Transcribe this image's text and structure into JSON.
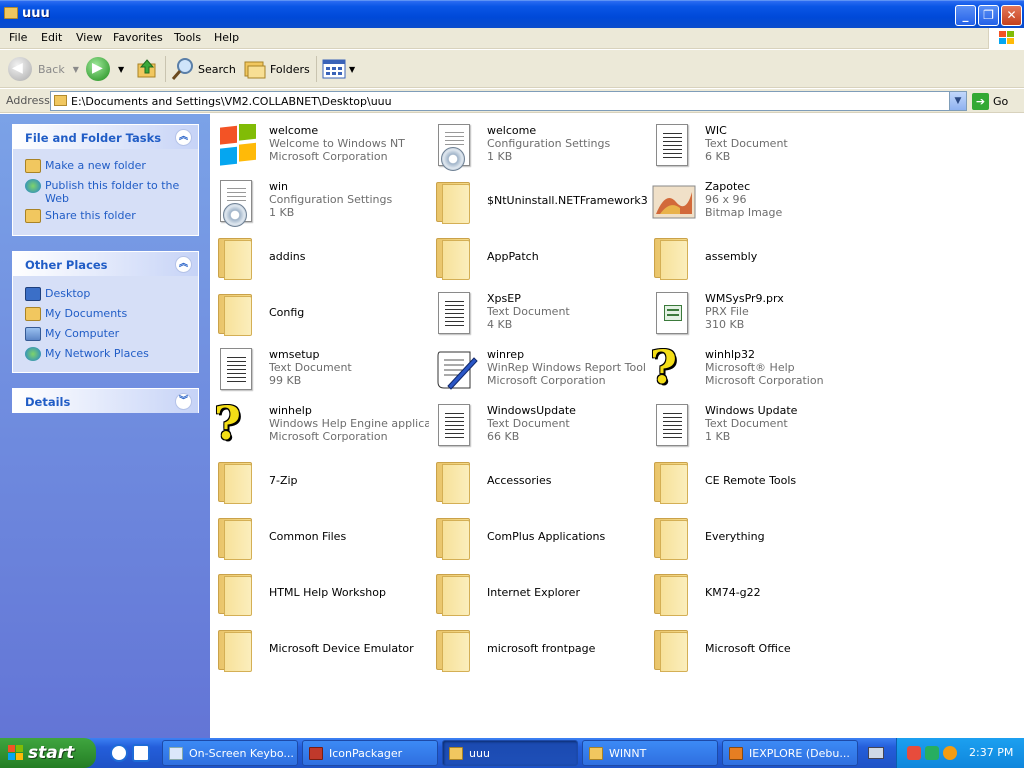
{
  "window": {
    "title": "uuu"
  },
  "menubar": {
    "items": [
      "File",
      "Edit",
      "View",
      "Favorites",
      "Tools",
      "Help"
    ]
  },
  "toolbar": {
    "back_label": "Back",
    "search_label": "Search",
    "folders_label": "Folders"
  },
  "address": {
    "label": "Address",
    "value": "E:\\Documents and Settings\\VM2.COLLABNET\\Desktop\\uuu",
    "go_label": "Go"
  },
  "tasks_panel": {
    "title": "File and Folder Tasks",
    "items": [
      "Make a new folder",
      "Publish this folder to the Web",
      "Share this folder"
    ]
  },
  "places_panel": {
    "title": "Other Places",
    "items": [
      "Desktop",
      "My Documents",
      "My Computer",
      "My Network Places"
    ]
  },
  "details_panel": {
    "title": "Details"
  },
  "files": [
    {
      "name": "welcome",
      "line2": "Welcome to Windows NT",
      "line3": "Microsoft Corporation",
      "icon": "windows-flag-icon"
    },
    {
      "name": "welcome",
      "line2": "Configuration Settings",
      "line3": "1 KB",
      "icon": "config-file-icon"
    },
    {
      "name": "WIC",
      "line2": "Text Document",
      "line3": "6 KB",
      "icon": "text-document-icon"
    },
    {
      "name": "win",
      "line2": "Configuration Settings",
      "line3": "1 KB",
      "icon": "config-file-icon"
    },
    {
      "name": "$NtUninstall.NETFramework3....",
      "line2": "",
      "line3": "",
      "icon": "folder-icon"
    },
    {
      "name": "Zapotec",
      "line2": "96 x 96",
      "line3": "Bitmap Image",
      "icon": "bitmap-image-icon"
    },
    {
      "name": "addins",
      "line2": "",
      "line3": "",
      "icon": "folder-icon"
    },
    {
      "name": "AppPatch",
      "line2": "",
      "line3": "",
      "icon": "folder-icon"
    },
    {
      "name": "assembly",
      "line2": "",
      "line3": "",
      "icon": "folder-icon"
    },
    {
      "name": "Config",
      "line2": "",
      "line3": "",
      "icon": "folder-icon"
    },
    {
      "name": "XpsEP",
      "line2": "Text Document",
      "line3": "4 KB",
      "icon": "text-document-icon"
    },
    {
      "name": "WMSysPr9.prx",
      "line2": "PRX File",
      "line3": "310 KB",
      "icon": "prx-file-icon"
    },
    {
      "name": "wmsetup",
      "line2": "Text Document",
      "line3": "99 KB",
      "icon": "text-document-icon"
    },
    {
      "name": "winrep",
      "line2": "WinRep Windows Report Tool",
      "line3": "Microsoft Corporation",
      "icon": "report-tool-icon"
    },
    {
      "name": "winhlp32",
      "line2": "Microsoft® Help",
      "line3": "Microsoft Corporation",
      "icon": "help-icon"
    },
    {
      "name": "winhelp",
      "line2": "Windows Help Engine applicati...",
      "line3": "Microsoft Corporation",
      "icon": "help-icon"
    },
    {
      "name": "WindowsUpdate",
      "line2": "Text Document",
      "line3": "66 KB",
      "icon": "text-document-icon"
    },
    {
      "name": "Windows Update",
      "line2": "Text Document",
      "line3": "1 KB",
      "icon": "text-document-icon"
    },
    {
      "name": "7-Zip",
      "line2": "",
      "line3": "",
      "icon": "folder-icon"
    },
    {
      "name": "Accessories",
      "line2": "",
      "line3": "",
      "icon": "folder-icon"
    },
    {
      "name": "CE Remote Tools",
      "line2": "",
      "line3": "",
      "icon": "folder-icon"
    },
    {
      "name": "Common Files",
      "line2": "",
      "line3": "",
      "icon": "folder-icon"
    },
    {
      "name": "ComPlus Applications",
      "line2": "",
      "line3": "",
      "icon": "folder-icon"
    },
    {
      "name": "Everything",
      "line2": "",
      "line3": "",
      "icon": "folder-icon"
    },
    {
      "name": "HTML Help Workshop",
      "line2": "",
      "line3": "",
      "icon": "folder-icon"
    },
    {
      "name": "Internet Explorer",
      "line2": "",
      "line3": "",
      "icon": "folder-icon"
    },
    {
      "name": "KM74-g22",
      "line2": "",
      "line3": "",
      "icon": "folder-icon"
    },
    {
      "name": "Microsoft Device Emulator",
      "line2": "",
      "line3": "",
      "icon": "folder-icon"
    },
    {
      "name": "microsoft frontpage",
      "line2": "",
      "line3": "",
      "icon": "folder-icon"
    },
    {
      "name": "Microsoft Office",
      "line2": "",
      "line3": "",
      "icon": "folder-icon"
    }
  ],
  "taskbar": {
    "start_label": "start",
    "tasks": [
      "On-Screen Keybo...",
      "IconPackager",
      "uuu",
      "WINNT",
      "IEXPLORE (Debu..."
    ],
    "clock": "2:37 PM"
  }
}
